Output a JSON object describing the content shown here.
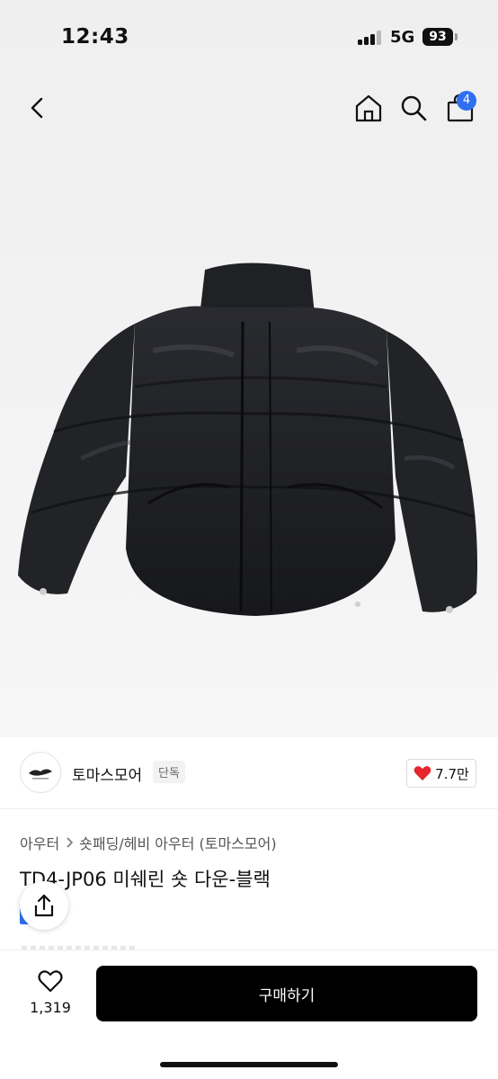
{
  "status_bar": {
    "time": "12:43",
    "network": "5G",
    "battery": "93"
  },
  "nav": {
    "cart_count": "4",
    "icons": [
      "back-icon",
      "home-icon",
      "search-icon",
      "shopping-bag-icon"
    ]
  },
  "product": {
    "image_icon": "black-puffer-jacket",
    "brand": {
      "name": "토마스모어",
      "tag": "단독"
    },
    "likes": "7.7만",
    "breadcrumb": {
      "category": "아우터",
      "subcategory": "숏패딩/헤비 아우터 (토마스모어)"
    },
    "title": "TD4-JP06 미쉐린 숏 다운-블랙"
  },
  "bottom_bar": {
    "wishlist_count": "1,319",
    "buy_label": "구매하기"
  },
  "colors": {
    "accent": "#2f6ff0",
    "heart": "#e5262d",
    "buy_button": "#000000"
  }
}
